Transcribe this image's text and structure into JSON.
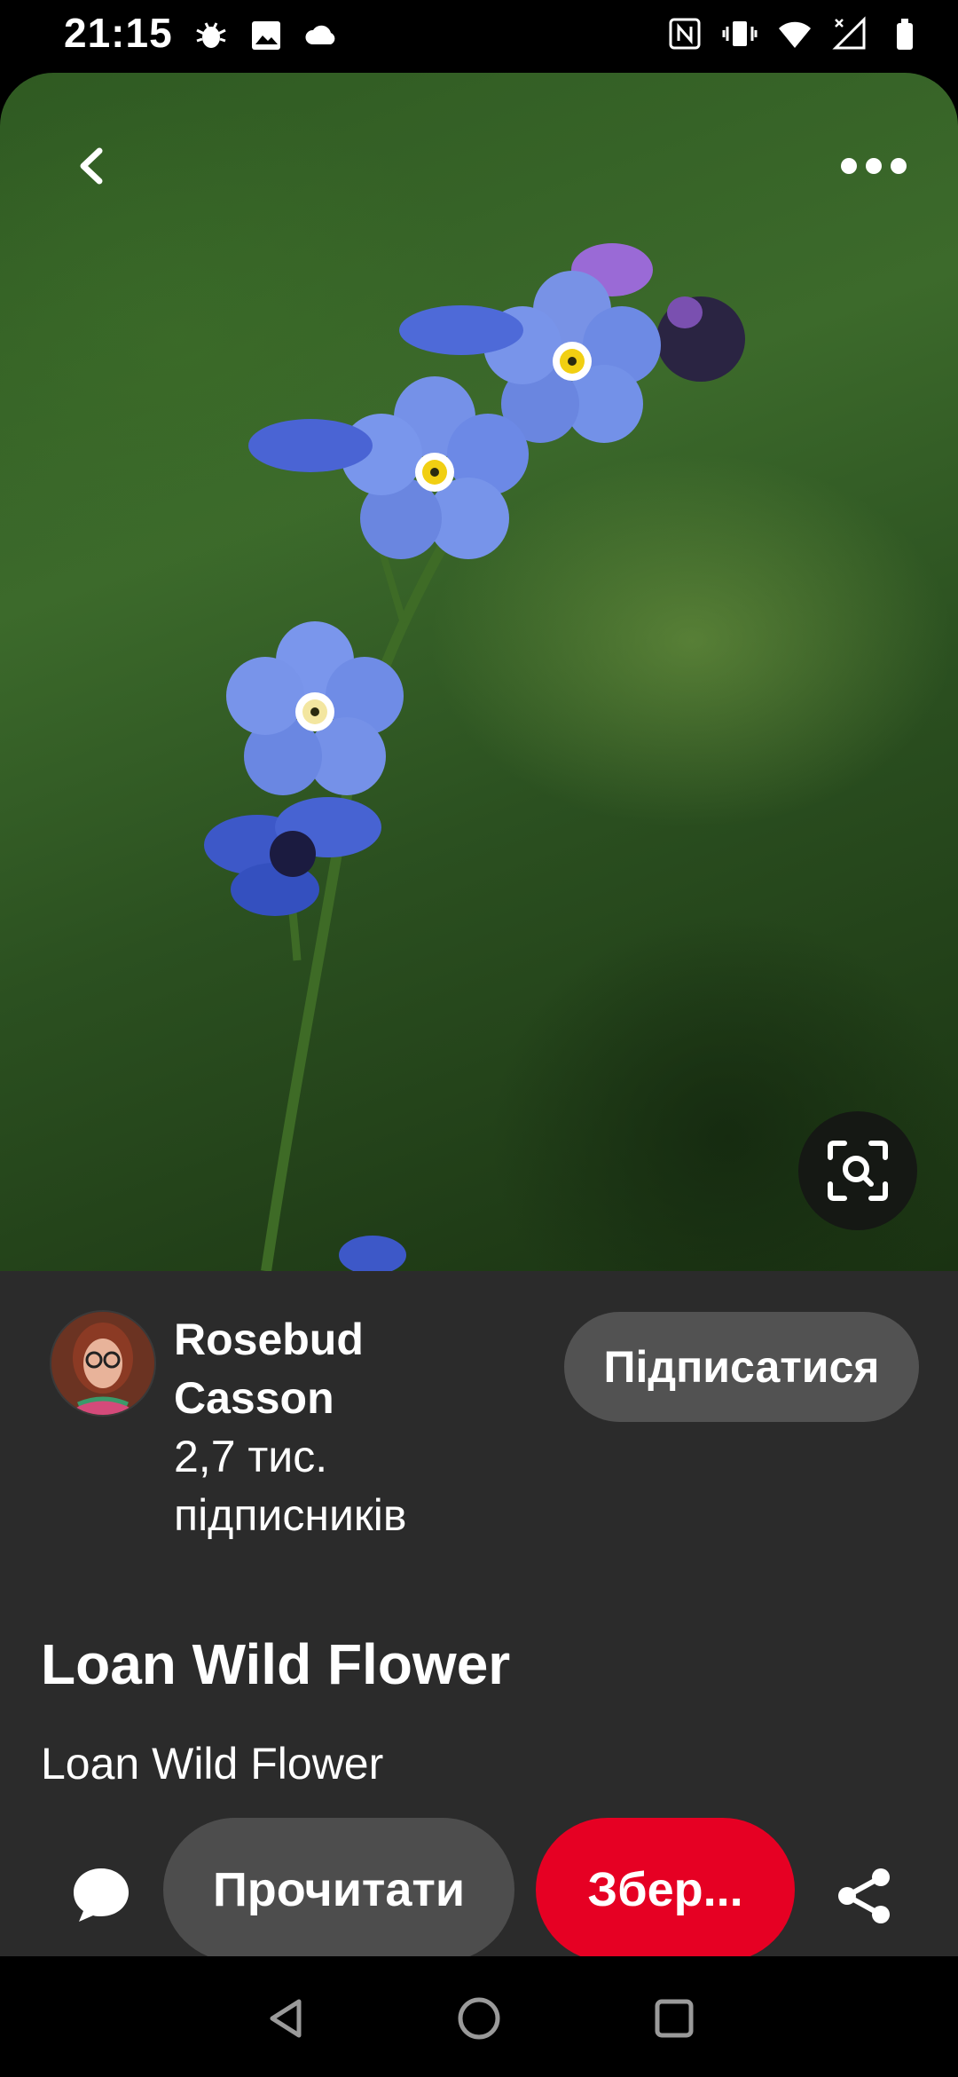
{
  "status_bar": {
    "time": "21:15",
    "left_icons": [
      "bug-notification-icon",
      "image-notification-icon",
      "cloud-notification-icon"
    ],
    "right_icons": [
      "nfc-icon",
      "vibrate-icon",
      "wifi-icon",
      "signal-icon",
      "battery-icon"
    ]
  },
  "hero": {
    "description_icons": [
      "back-arrow-icon",
      "more-dots-icon",
      "visual-search-icon"
    ]
  },
  "creator": {
    "name": "Rosebud Casson",
    "followers": "2,7 тис. підписників",
    "follow_label": "Підписатися"
  },
  "pin": {
    "title": "Loan Wild Flower",
    "description": "Loan Wild Flower"
  },
  "actions": {
    "read_label": "Прочитати",
    "save_label": "Збер..."
  },
  "colors": {
    "save": "#e60023",
    "panel": "#2b2b2b",
    "pill": "#4d4d4d"
  }
}
